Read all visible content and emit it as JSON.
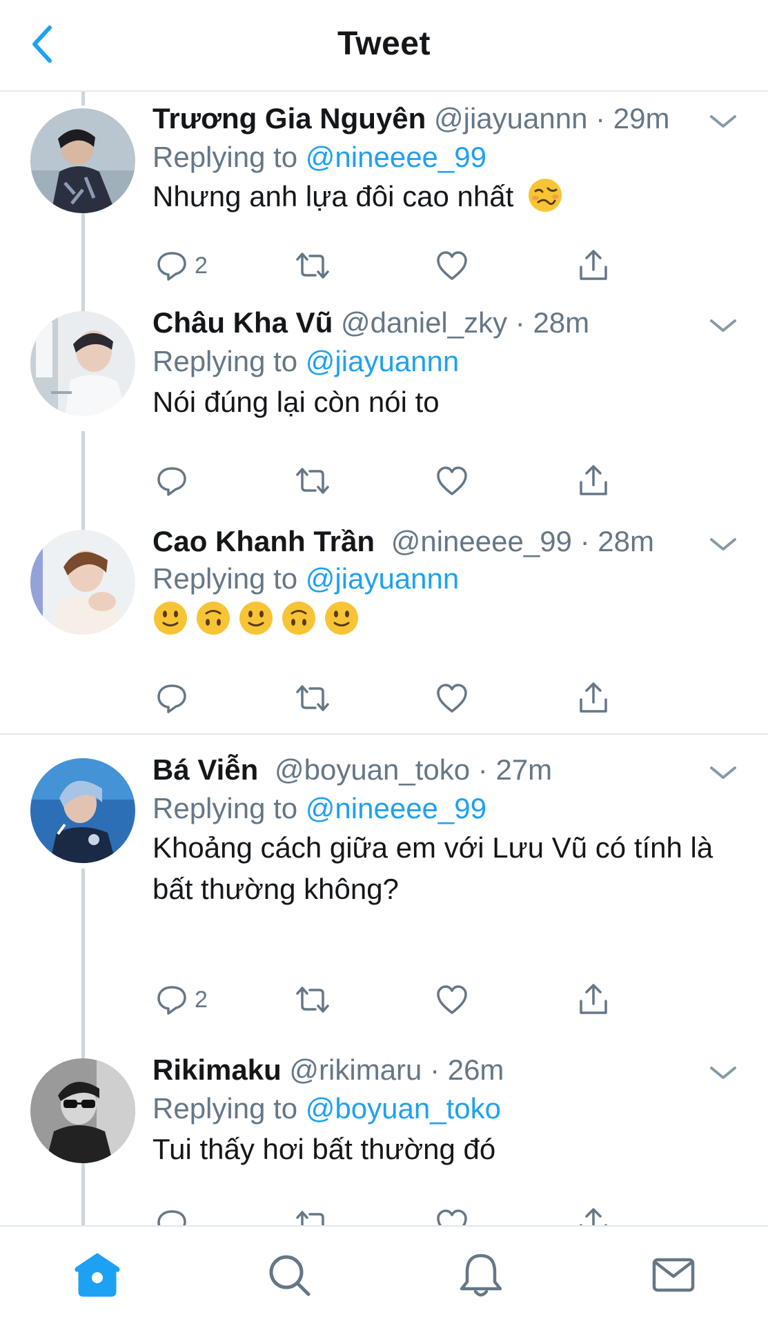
{
  "header": {
    "title": "Tweet",
    "back_icon": "chevron-left-icon"
  },
  "colors": {
    "accent": "#1da1f2",
    "text": "#14171a",
    "secondary_text": "#657786",
    "divider": "#e1e8ed",
    "thread_line": "#ccd6dd"
  },
  "tweets": [
    {
      "display_name": "Trương Gia Nguyên",
      "meta": "@jiayuannn · 29m",
      "replying_prefix": "Replying to ",
      "replying_handle": "@nineeee_99",
      "text": "Nhưng anh lựa đôi cao nhất",
      "emoji": [
        "woozy-face"
      ],
      "reply_count": "2"
    },
    {
      "display_name": "Châu Kha Vũ",
      "meta": "@daniel_zky · 28m",
      "replying_prefix": "Replying to ",
      "replying_handle": "@jiayuannn",
      "text": "Nói đúng lại còn nói to",
      "reply_count": ""
    },
    {
      "display_name": "Cao Khanh Trần",
      "meta": "@nineeee_99 · 28m",
      "replying_prefix": "Replying to ",
      "replying_handle": "@jiayuannn",
      "text": "",
      "emoji": [
        "slightly-smiling-face",
        "upside-down-face",
        "slightly-smiling-face",
        "upside-down-face",
        "slightly-smiling-face"
      ],
      "reply_count": ""
    },
    {
      "display_name": "Bá Viễn",
      "meta": "@boyuan_toko · 27m",
      "replying_prefix": "Replying to ",
      "replying_handle": "@nineeee_99",
      "text": "Khoảng cách giữa em với Lưu Vũ có tính là bất thường không?",
      "reply_count": "2"
    },
    {
      "display_name": "Rikimaku",
      "meta": "@rikimaru · 26m",
      "replying_prefix": "Replying to ",
      "replying_handle": "@boyuan_toko",
      "text": "Tui thấy hơi bất thường đó",
      "reply_count": ""
    }
  ],
  "action_icons": [
    "reply-icon",
    "retweet-icon",
    "like-icon",
    "share-icon"
  ],
  "tabbar": {
    "items": [
      "home-icon",
      "search-icon",
      "notifications-icon",
      "messages-icon"
    ],
    "active": "home-icon"
  }
}
